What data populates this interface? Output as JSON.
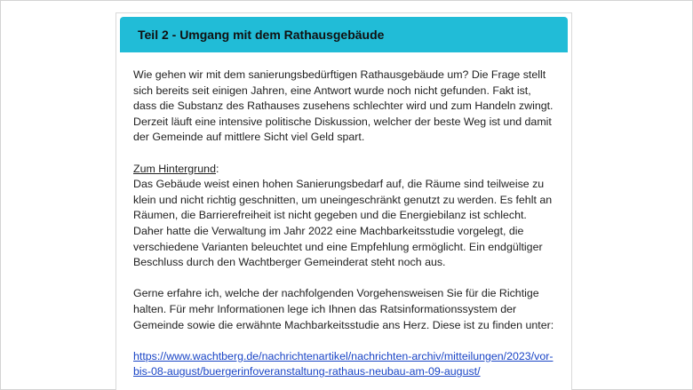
{
  "header": {
    "title": "Teil 2 - Umgang mit dem Rathausgebäude"
  },
  "intro": "Wie gehen wir mit dem sanierungsbedürftigen Rathausgebäude um? Die Frage stellt sich bereits seit einigen Jahren, eine Antwort wurde noch nicht gefunden. Fakt ist, dass die Substanz des Rathauses zusehens schlechter wird und zum Handeln zwingt. Derzeit läuft eine intensive politische Diskussion, welcher der beste Weg ist und damit der Gemeinde auf mittlere Sicht viel Geld spart.",
  "background": {
    "heading": "Zum Hintergrund",
    "heading_suffix": ":",
    "text": "Das Gebäude weist einen hohen Sanierungsbedarf auf, die Räume sind teilweise zu klein und nicht richtig geschnitten, um uneingeschränkt genutzt zu werden. Es fehlt an Räumen, die Barrierefreiheit ist nicht gegeben und die Energiebilanz ist schlecht. Daher hatte die Verwaltung im Jahr 2022 eine Machbarkeitsstudie vorgelegt, die verschiedene Varianten beleuchtet und eine Empfehlung ermöglicht. Ein endgültiger Beschluss durch den Wachtberger Gemeinderat steht noch aus."
  },
  "request": "Gerne erfahre ich, welche der nachfolgenden Vorgehensweisen Sie für die Richtige halten. Für mehr Informationen lege ich Ihnen das Ratsinformationssystem der Gemeinde sowie die erwähnte Machbarkeitsstudie ans Herz. Diese ist zu finden unter:",
  "link": {
    "text": "https://www.wachtberg.de/nachrichtenartikel/nachrichten-archiv/mitteilungen/2023/vor-bis-08-august/buergerinfoveranstaltung-rathaus-neubau-am-09-august/"
  },
  "colors": {
    "header_bg": "#21bcd7",
    "link": "#1a45c6",
    "text": "#222222"
  }
}
